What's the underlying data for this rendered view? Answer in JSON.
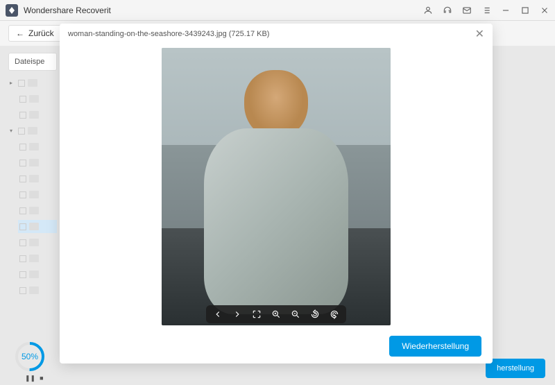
{
  "app": {
    "title": "Wondershare Recoverit"
  },
  "toolbar": {
    "back_label": "Zurück"
  },
  "sidebar": {
    "header": "Dateispe"
  },
  "progress": {
    "percent": "50",
    "suffix": "%"
  },
  "footer_button": "herstellung",
  "modal": {
    "filename": "woman-standing-on-the-seashore-3439243.jpg",
    "filesize": "(725.17 KB)",
    "recover_label": "Wiederherstellung"
  }
}
